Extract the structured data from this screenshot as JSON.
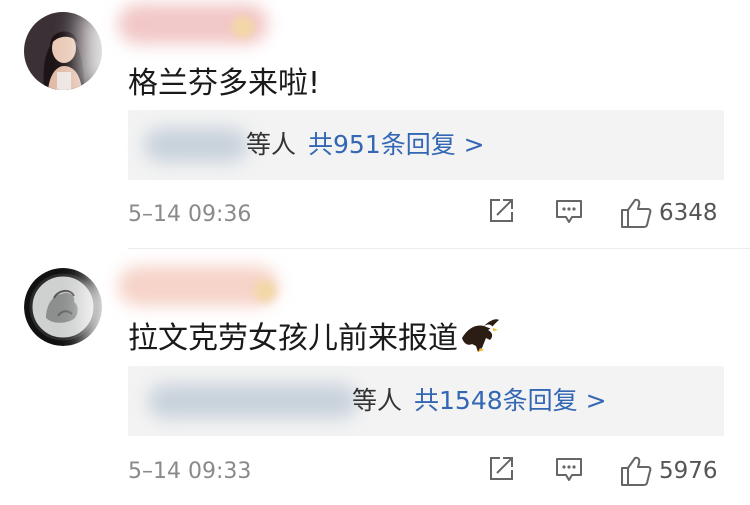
{
  "comments": [
    {
      "text": "格兰芬多来啦!",
      "reply_summary": {
        "who_suffix": "等人",
        "count_text": "共951条回复 >"
      },
      "timestamp": "5–14 09:36",
      "likes": "6348",
      "avatar_icon": "user-photo"
    },
    {
      "text": "拉文克劳女孩儿前来报道",
      "emoji_icon": "eagle-emoji",
      "reply_summary": {
        "who_suffix": "等人",
        "count_text": "共1548条回复 >"
      },
      "timestamp": "5–14 09:33",
      "likes": "5976",
      "avatar_icon": "grayscale-user-photo"
    }
  ],
  "icons": {
    "share": "share-icon",
    "comment": "comment-icon",
    "like": "thumbs-up-icon"
  },
  "colors": {
    "link": "#3367b4",
    "meta": "#8a8a8a",
    "reply_bg": "#f3f3f3"
  }
}
